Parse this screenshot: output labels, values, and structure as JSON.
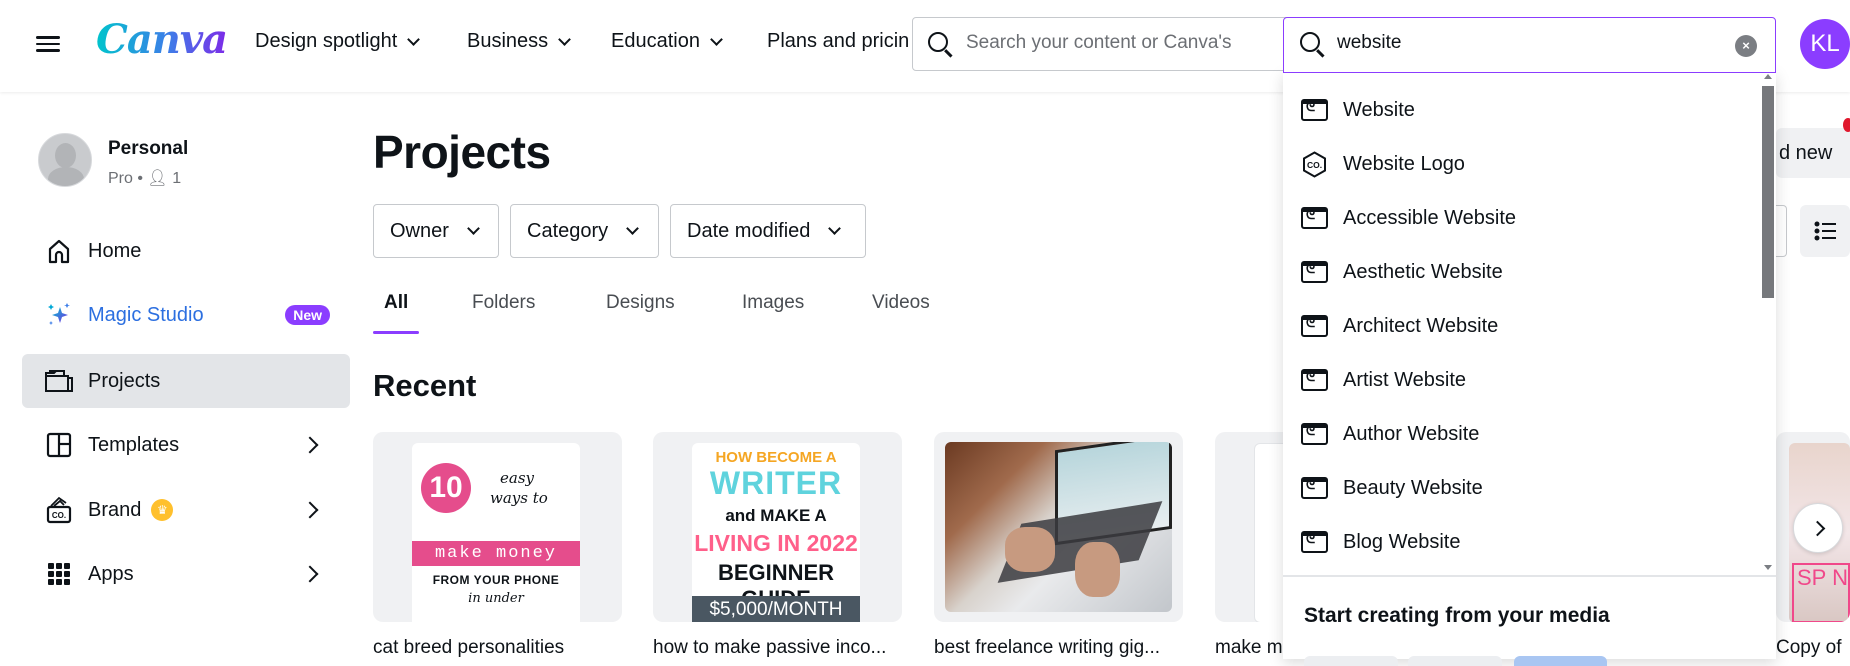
{
  "header": {
    "logo": "Canva",
    "nav": [
      {
        "label": "Design spotlight",
        "has_dropdown": true
      },
      {
        "label": "Business",
        "has_dropdown": true
      },
      {
        "label": "Education",
        "has_dropdown": true
      },
      {
        "label": "Plans and pricin",
        "has_dropdown": false
      }
    ],
    "search_placeholder": "Search your content or Canva's",
    "search_active_value": "website",
    "clear_icon": "×",
    "avatar_initials": "KL",
    "accent_color": "#8b3dff"
  },
  "sidebar": {
    "profile": {
      "name": "Personal",
      "plan": "Pro",
      "separator": "•",
      "members_icon": "8",
      "members": "1"
    },
    "items": [
      {
        "label": "Home",
        "icon": "home-icon"
      },
      {
        "label": "Magic Studio",
        "icon": "sparkle-icon",
        "badge": "New"
      },
      {
        "label": "Projects",
        "icon": "folder-icon",
        "active": true
      },
      {
        "label": "Templates",
        "icon": "templates-icon",
        "has_arrow": true
      },
      {
        "label": "Brand",
        "icon": "brand-icon",
        "has_arrow": true,
        "crown": "♛"
      },
      {
        "label": "Apps",
        "icon": "apps-grid-icon",
        "has_arrow": true
      }
    ]
  },
  "main": {
    "title": "Projects",
    "filters": [
      "Owner",
      "Category",
      "Date modified"
    ],
    "tabs": [
      "All",
      "Folders",
      "Designs",
      "Images",
      "Videos"
    ],
    "active_tab": "All",
    "section_title": "Recent",
    "cards": [
      {
        "caption": "cat breed personalities",
        "thumb": {
          "number": "10",
          "line1": "easy",
          "line2": "ways to",
          "band": "make money",
          "line3": "FROM YOUR PHONE",
          "line4": "in under"
        }
      },
      {
        "caption": "how to make passive inco...",
        "thumb": {
          "line1": "HOW BECOME A",
          "line2": "WRITER",
          "line3": "and MAKE A",
          "line4": "LIVING IN 2022",
          "line5": "BEGINNER GUIDE",
          "band": "$5,000/MONTH"
        }
      },
      {
        "caption": "best freelance writing gig...",
        "thumb": {}
      },
      {
        "caption": "make m",
        "thumb": {}
      },
      {
        "caption": "Copy of",
        "thumb": {
          "text": "SP N"
        }
      }
    ],
    "add_new_label": "d new"
  },
  "dropdown": {
    "suggestions": [
      {
        "label": "Website",
        "icon": "website-icon"
      },
      {
        "label": "Website Logo",
        "icon": "logo-icon"
      },
      {
        "label": "Accessible Website",
        "icon": "website-icon"
      },
      {
        "label": "Aesthetic Website",
        "icon": "website-icon"
      },
      {
        "label": "Architect Website",
        "icon": "website-icon"
      },
      {
        "label": "Artist Website",
        "icon": "website-icon"
      },
      {
        "label": "Author Website",
        "icon": "website-icon"
      },
      {
        "label": "Beauty Website",
        "icon": "website-icon"
      },
      {
        "label": "Blog Website",
        "icon": "website-icon"
      }
    ],
    "media_section_title": "Start creating from your media"
  }
}
